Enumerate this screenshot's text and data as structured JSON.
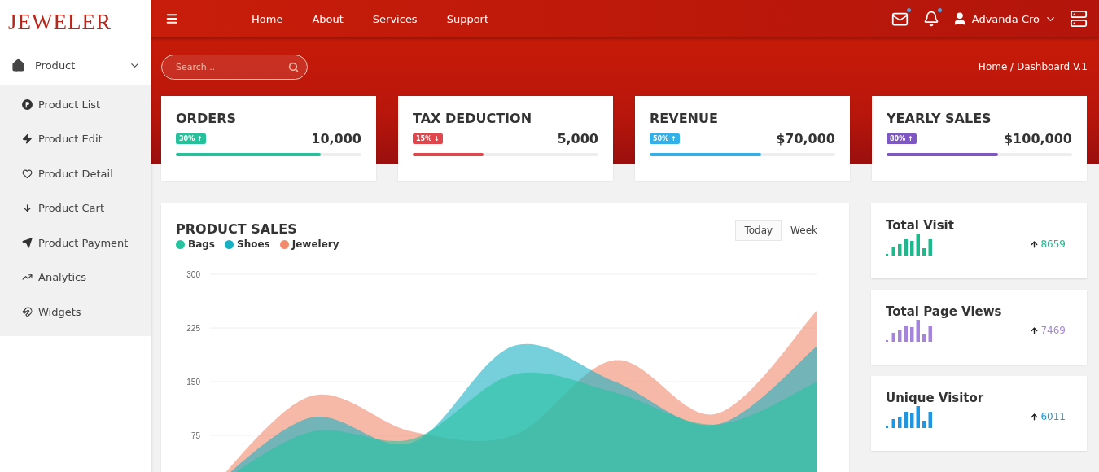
{
  "logo": "JEWELER",
  "sidebar": {
    "items": [
      {
        "label": "Product",
        "expanded": true,
        "children": [
          {
            "label": "Product List"
          },
          {
            "label": "Product Edit"
          },
          {
            "label": "Product Detail"
          },
          {
            "label": "Product Cart"
          },
          {
            "label": "Product Payment"
          },
          {
            "label": "Analytics"
          },
          {
            "label": "Widgets"
          }
        ]
      }
    ]
  },
  "topnav": {
    "links": [
      "Home",
      "About",
      "Services",
      "Support"
    ],
    "user": "Advanda Cro",
    "mail_unread": true,
    "bell_unread": true
  },
  "search": {
    "placeholder": "Search..."
  },
  "breadcrumb": "Home / Dashboard V.1",
  "stats": [
    {
      "title": "ORDERS",
      "badge": "30% ↑",
      "value": "10,000",
      "level": 0.78,
      "color": "#26c19b"
    },
    {
      "title": "TAX DEDUCTION",
      "badge": "15% ↓",
      "value": "5,000",
      "level": 0.38,
      "color": "#e0474c"
    },
    {
      "title": "REVENUE",
      "badge": "50% ↑",
      "value": "$70,000",
      "level": 0.6,
      "color": "#33b0e8"
    },
    {
      "title": "YEARLY SALES",
      "badge": "80% ↑",
      "value": "$100,000",
      "level": 0.6,
      "color": "#7e57c2"
    }
  ],
  "product_sales": {
    "title": "PRODUCT SALES",
    "tabs": [
      {
        "label": "Today",
        "selected": true
      },
      {
        "label": "Week",
        "selected": false
      }
    ],
    "chart_data": {
      "type": "area",
      "grid": true,
      "ylim": [
        0,
        300
      ],
      "yticks": [
        75,
        150,
        225,
        300
      ],
      "series": [
        {
          "name": "Bags",
          "color": "#28c2a0",
          "values": [
            0,
            80,
            70,
            160,
            135,
            90,
            150
          ]
        },
        {
          "name": "Shoes",
          "color": "#1ab0c4",
          "values": [
            0,
            100,
            65,
            200,
            150,
            90,
            200
          ]
        },
        {
          "name": "Jewelery",
          "color": "#f28b6c",
          "values": [
            0,
            130,
            80,
            75,
            180,
            105,
            250
          ]
        }
      ]
    }
  },
  "mini_stats": [
    {
      "title": "Total Visit",
      "value": "8659",
      "color": "#1fb78c"
    },
    {
      "title": "Total Page Views",
      "value": "7469",
      "color": "#a585d9"
    },
    {
      "title": "Unique Visitor",
      "value": "6011",
      "color": "#2196e0"
    }
  ]
}
